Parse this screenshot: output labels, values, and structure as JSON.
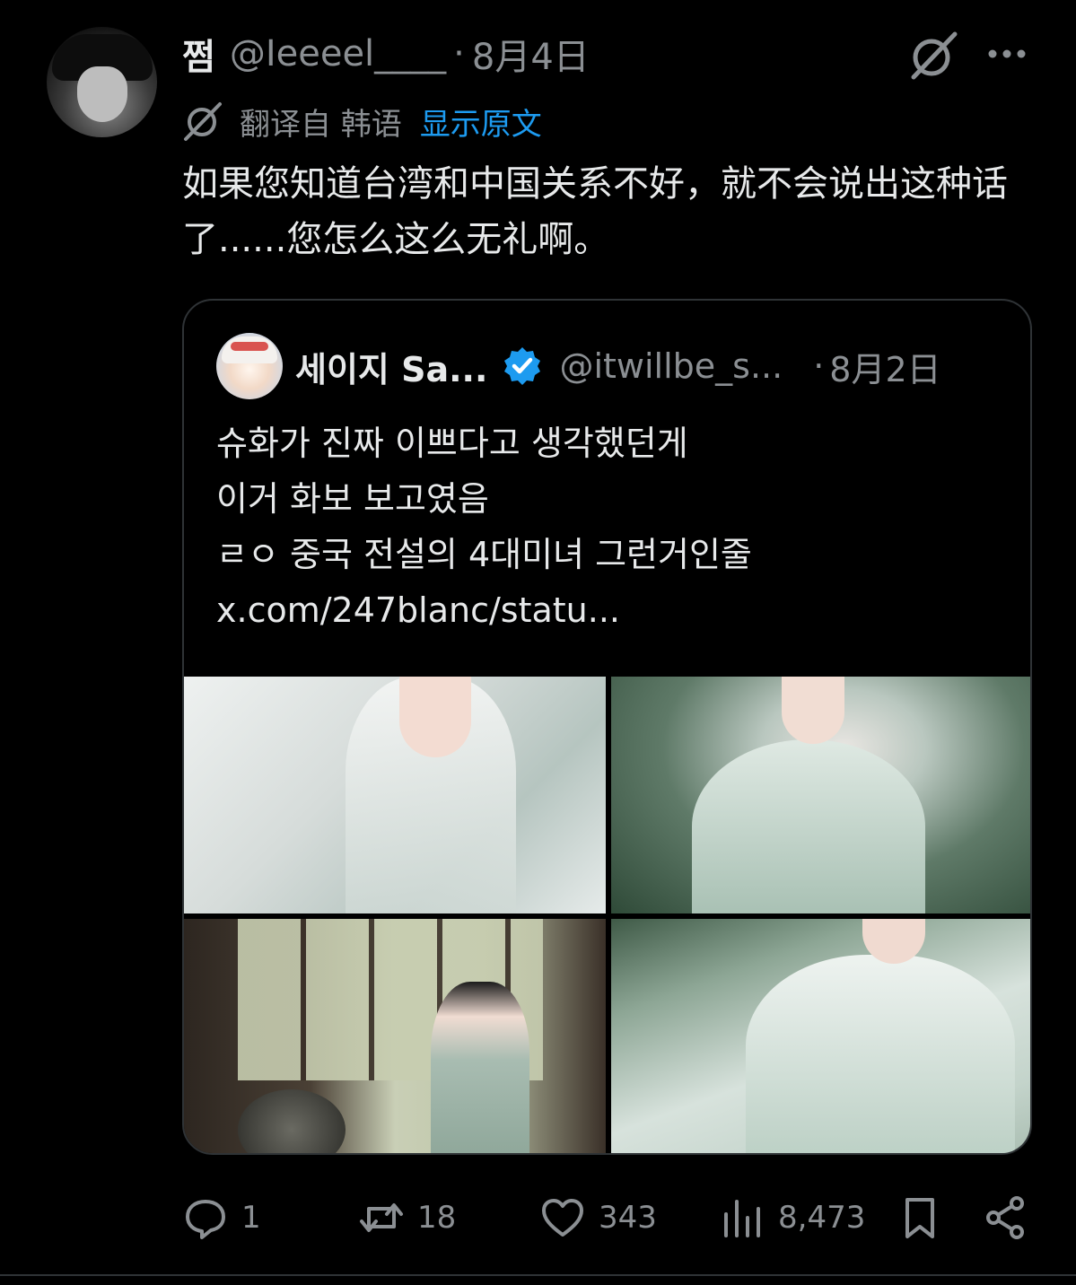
{
  "tweet": {
    "display_name": "쩜",
    "handle": "@Ieeeel____",
    "separator": "·",
    "date": "8月4日",
    "translation": {
      "label": "翻译自 韩语",
      "show_original": "显示原文"
    },
    "text": "如果您知道台湾和中国关系不好，就不会说出这种话了......您怎么这么无礼啊。",
    "icons": {
      "grok": "grok-slash-icon",
      "more": "more-dots-icon",
      "translate": "translate-icon"
    }
  },
  "quote": {
    "display_name": "세이지 Sa...",
    "handle": "@itwillbe_s...",
    "separator": "·",
    "date": "8月2日",
    "verified_color": "#1d9bf0",
    "lines": [
      "슈화가 진짜 이쁘다고 생각했던게",
      "이거 화보 보고였음",
      "ㄹㅇ 중국 전설의 4대미녀 그런거인줄"
    ],
    "link": "x.com/247blanc/statu..."
  },
  "actions": {
    "reply_count": "1",
    "repost_count": "18",
    "like_count": "343",
    "view_count": "8,473"
  },
  "colors": {
    "background": "#000000",
    "text": "#e7e9ea",
    "secondary": "#8b8f93",
    "accent": "#1d9bf0",
    "border": "#2f3336"
  }
}
